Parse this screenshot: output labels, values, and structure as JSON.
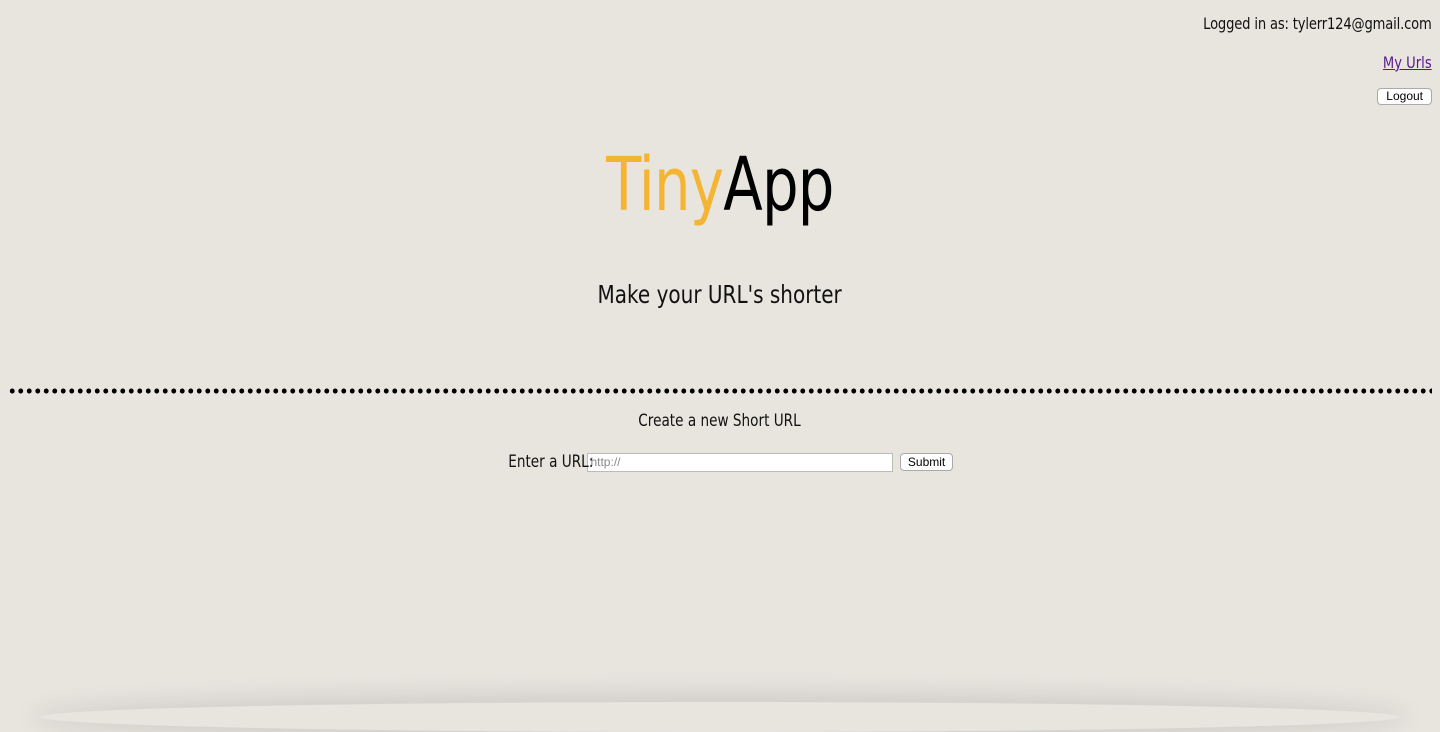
{
  "header": {
    "logged_in_text": "Logged in as: tylerr124@gmail.com",
    "my_urls_label": "My Urls",
    "logout_label": "Logout"
  },
  "logo": {
    "part1": "Tiny",
    "part2": "App",
    "part1_color": "#f4b434",
    "part2_color": "#000000"
  },
  "tagline": "Make your URL's shorter",
  "create": {
    "title": "Create a new Short URL",
    "label": "Enter a URL:",
    "placeholder": "http://",
    "submit_label": "Submit"
  },
  "colors": {
    "background": "#e8e5df",
    "link": "#551a8b"
  }
}
